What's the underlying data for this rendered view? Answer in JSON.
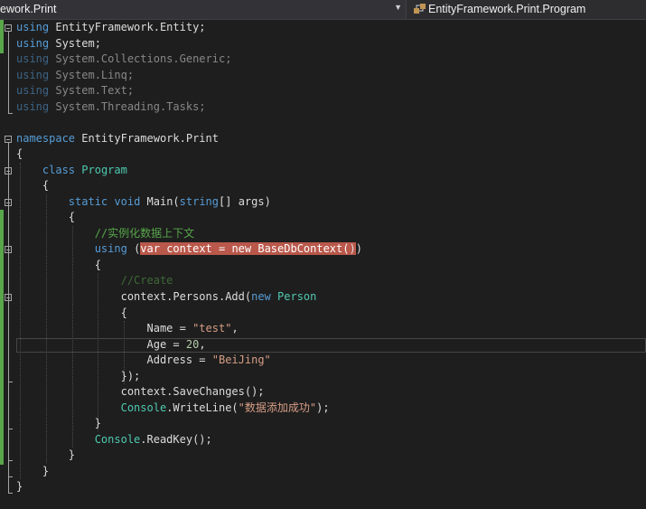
{
  "navbar": {
    "left_label": "ework.Print",
    "right_label": "EntityFramework.Print.Program",
    "left_icon": "chevron-down-icon",
    "right_icon": "class-icon"
  },
  "code": {
    "l1": {
      "kw": "using",
      "rest": " EntityFramework.Entity;"
    },
    "l2": {
      "kw": "using",
      "rest": " System;"
    },
    "l3": {
      "kw": "using",
      "rest": " System.Collections.Generic;"
    },
    "l4": {
      "kw": "using",
      "rest": " System.Linq;"
    },
    "l5": {
      "kw": "using",
      "rest": " System.Text;"
    },
    "l6": {
      "kw": "using",
      "rest": " System.Threading.Tasks;"
    },
    "l8": {
      "kw": "namespace",
      "rest": " EntityFramework.Print"
    },
    "l9": "{",
    "l10": {
      "kw": "class",
      "type": "Program"
    },
    "l11": "{",
    "l12": {
      "kw1": "static",
      "kw2": "void",
      "name": "Main(",
      "kw3": "string",
      "rest": "[] args)"
    },
    "l13": "{",
    "l14": "//实例化数据上下文",
    "l15": {
      "kw": "using",
      "p1": "(",
      "hl": "var context = new BaseDbContext(",
      "hl2": ")",
      "p2": ")"
    },
    "l16": "{",
    "l17": "//Create",
    "l18": {
      "pre": "context.Persons.Add(",
      "kw": "new",
      "type": "Person"
    },
    "l19": "{",
    "l20": {
      "pre": "Name = ",
      "str": "\"test\"",
      "post": ","
    },
    "l21": {
      "pre": "Age = ",
      "num": "20",
      "post": ","
    },
    "l22": {
      "pre": "Address = ",
      "str": "\"BeiJing\""
    },
    "l23": "});",
    "l24": "context.SaveChanges();",
    "l25": {
      "type": "Console",
      "pre": ".WriteLine(",
      "str": "\"数据添加成功\"",
      "post": ");"
    },
    "l26": "}",
    "l27": {
      "type": "Console",
      "pre": ".ReadKey();"
    },
    "l28": "}",
    "l29": "}",
    "l30": "}"
  },
  "colors": {
    "keyword": "#569cd6",
    "type": "#4ec9b0",
    "string": "#d69d85",
    "comment": "#57a64a",
    "highlight": "#b9584b"
  }
}
